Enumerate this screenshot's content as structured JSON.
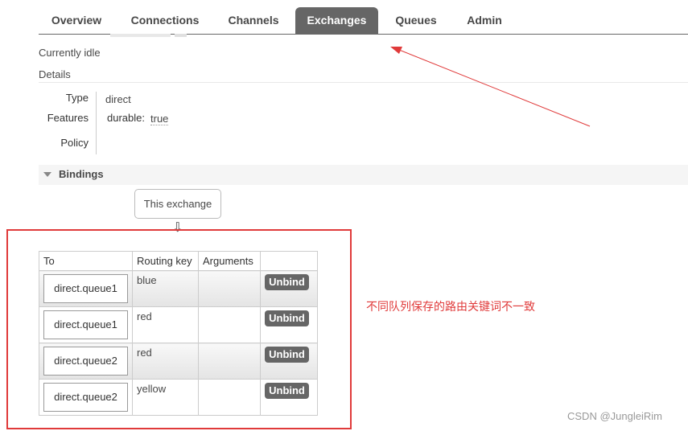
{
  "tabs": [
    {
      "label": "Overview"
    },
    {
      "label": "Connections"
    },
    {
      "label": "Channels"
    },
    {
      "label": "Exchanges",
      "active": true
    },
    {
      "label": "Queues"
    },
    {
      "label": "Admin"
    }
  ],
  "status": "Currently idle",
  "details": {
    "heading": "Details",
    "type_label": "Type",
    "type_value": "direct",
    "features_label": "Features",
    "features_key": "durable:",
    "features_value": "true",
    "policy_label": "Policy"
  },
  "bindings": {
    "title": "Bindings",
    "source": "This exchange",
    "arrow": "⇩",
    "columns": [
      "To",
      "Routing key",
      "Arguments",
      ""
    ],
    "rows": [
      {
        "to": "direct.queue1",
        "routing_key": "blue",
        "arguments": "",
        "action": "Unbind"
      },
      {
        "to": "direct.queue1",
        "routing_key": "red",
        "arguments": "",
        "action": "Unbind"
      },
      {
        "to": "direct.queue2",
        "routing_key": "red",
        "arguments": "",
        "action": "Unbind"
      },
      {
        "to": "direct.queue2",
        "routing_key": "yellow",
        "arguments": "",
        "action": "Unbind"
      }
    ]
  },
  "annotation": {
    "text": "不同队列保存的路由关键词不一致",
    "color": "#e03a3a"
  },
  "watermark": "CSDN @JungleiRim",
  "colors": {
    "tab_active_bg": "#666666",
    "button_bg": "#666666",
    "text": "#484848"
  }
}
